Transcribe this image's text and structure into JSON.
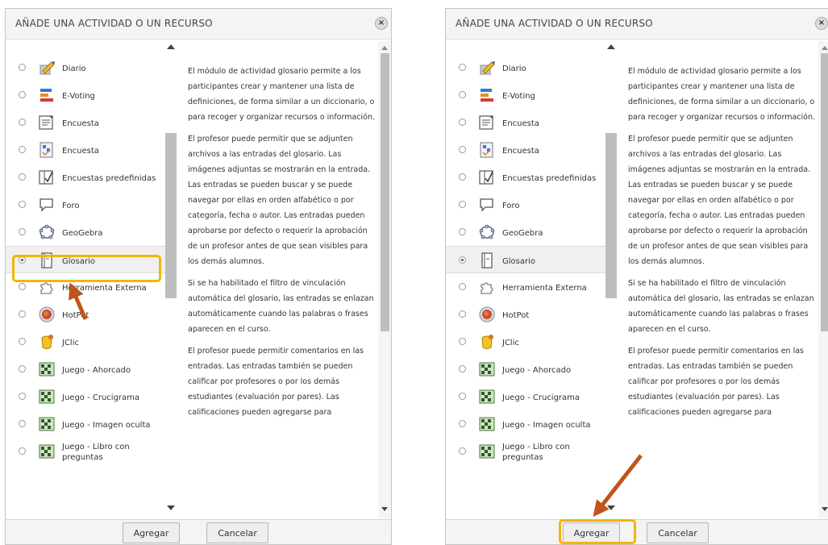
{
  "dialog_title": "AÑADE UNA ACTIVIDAD O UN RECURSO",
  "close_glyph": "×",
  "items": [
    {
      "label": "Diario",
      "icon": "diary-icon",
      "selected_left": false,
      "selected_right": false
    },
    {
      "label": "E-Voting",
      "icon": "evoting-icon",
      "selected_left": false,
      "selected_right": false
    },
    {
      "label": "Encuesta",
      "icon": "survey-icon",
      "selected_left": false,
      "selected_right": false
    },
    {
      "label": "Encuesta",
      "icon": "feedback-icon",
      "selected_left": false,
      "selected_right": false
    },
    {
      "label": "Encuestas predefinidas",
      "icon": "predefined-survey-icon",
      "selected_left": false,
      "selected_right": false
    },
    {
      "label": "Foro",
      "icon": "forum-icon",
      "selected_left": false,
      "selected_right": false
    },
    {
      "label": "GeoGebra",
      "icon": "geogebra-icon",
      "selected_left": false,
      "selected_right": false
    },
    {
      "label": "Glosario",
      "icon": "glossary-icon",
      "selected_left": true,
      "selected_right": true
    },
    {
      "label": "Herramienta Externa",
      "icon": "puzzle-icon",
      "selected_left": false,
      "selected_right": false
    },
    {
      "label": "HotPot",
      "icon": "hotpot-icon",
      "selected_left": false,
      "selected_right": false
    },
    {
      "label": "JClic",
      "icon": "jclic-icon",
      "selected_left": false,
      "selected_right": false
    },
    {
      "label": "Juego - Ahorcado",
      "icon": "game-icon",
      "selected_left": false,
      "selected_right": false
    },
    {
      "label": "Juego - Crucigrama",
      "icon": "game-icon",
      "selected_left": false,
      "selected_right": false
    },
    {
      "label": "Juego - Imagen oculta",
      "icon": "game-icon",
      "selected_left": false,
      "selected_right": false
    },
    {
      "label": "Juego - Libro con preguntas",
      "icon": "game-icon",
      "selected_left": false,
      "selected_right": false
    }
  ],
  "description": [
    "El módulo de actividad glosario permite a los participantes crear y mantener una lista de definiciones, de forma similar a un diccionario, o para recoger y organizar recursos o información.",
    "El profesor puede permitir que se adjunten archivos a las entradas del glosario. Las imágenes adjuntas se mostrarán en la entrada. Las entradas se pueden buscar y se puede navegar por ellas en orden alfabético o por categoría, fecha o autor. Las entradas pueden aprobarse por defecto o requerir la aprobación de un profesor antes de que sean visibles para los demás alumnos.",
    "Si se ha habilitado el filtro de vinculación automática del glosario, las entradas se enlazan automáticamente cuando las palabras o frases aparecen en el curso.",
    "El profesor puede permitir comentarios en las entradas. Las entradas también se pueden calificar por profesores o por los demás estudiantes (evaluación por pares). Las calificaciones pueden agregarse para"
  ],
  "buttons": {
    "agregar": "Agregar",
    "cancelar": "Cancelar"
  },
  "colors": {
    "highlight": "#f5b400",
    "arrow": "#c0541c"
  }
}
